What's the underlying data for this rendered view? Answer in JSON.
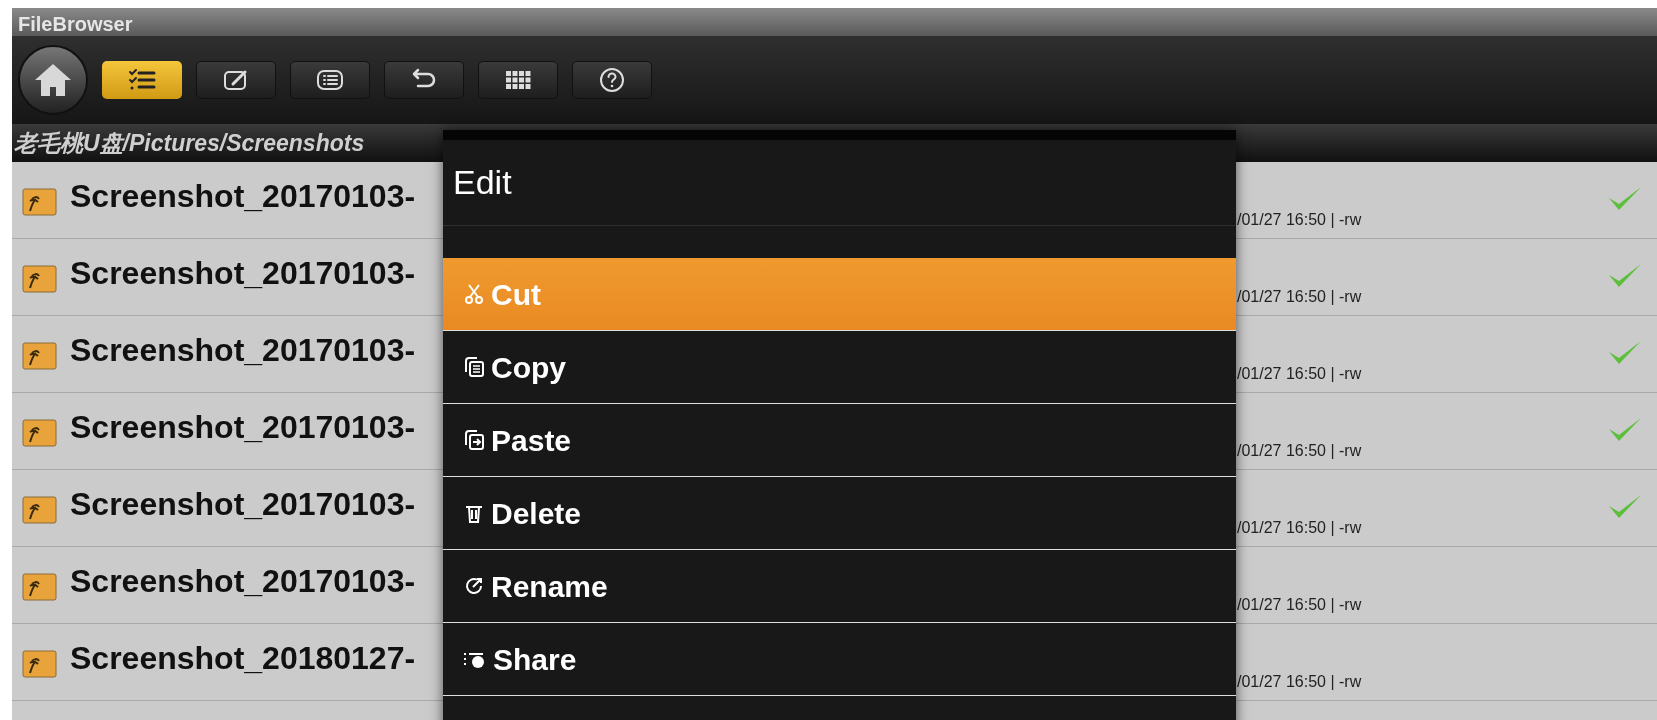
{
  "window": {
    "title": "FileBrowser"
  },
  "toolbar": [
    {
      "kind": "multiselect",
      "selected": true
    },
    {
      "kind": "edit",
      "selected": false
    },
    {
      "kind": "list",
      "selected": false
    },
    {
      "kind": "undo",
      "selected": false
    },
    {
      "kind": "grid",
      "selected": false
    },
    {
      "kind": "help",
      "selected": false
    }
  ],
  "path": "老毛桃U盘/Pictures/Screenshots",
  "files": [
    {
      "name": "Screenshot_20170103-",
      "meta": "/01/27 16:50 | -rw",
      "checked": true
    },
    {
      "name": "Screenshot_20170103-",
      "meta": "/01/27 16:50 | -rw",
      "checked": true
    },
    {
      "name": "Screenshot_20170103-",
      "meta": "/01/27 16:50 | -rw",
      "checked": true
    },
    {
      "name": "Screenshot_20170103-",
      "meta": "/01/27 16:50 | -rw",
      "checked": true
    },
    {
      "name": "Screenshot_20170103-",
      "meta": "/01/27 16:50 | -rw",
      "checked": true
    },
    {
      "name": "Screenshot_20170103-",
      "meta": "/01/27 16:50 | -rw",
      "checked": false
    },
    {
      "name": "Screenshot_20180127-",
      "meta": "/01/27 16:50 | -rw",
      "checked": false
    }
  ],
  "menu": {
    "title": "Edit",
    "items": [
      {
        "kind": "cut",
        "label": "Cut",
        "selected": true
      },
      {
        "kind": "copy",
        "label": "Copy",
        "selected": false
      },
      {
        "kind": "paste",
        "label": "Paste",
        "selected": false
      },
      {
        "kind": "delete",
        "label": "Delete",
        "selected": false
      },
      {
        "kind": "rename",
        "label": "Rename",
        "selected": false
      },
      {
        "kind": "share",
        "label": "Share",
        "selected": false
      }
    ]
  }
}
